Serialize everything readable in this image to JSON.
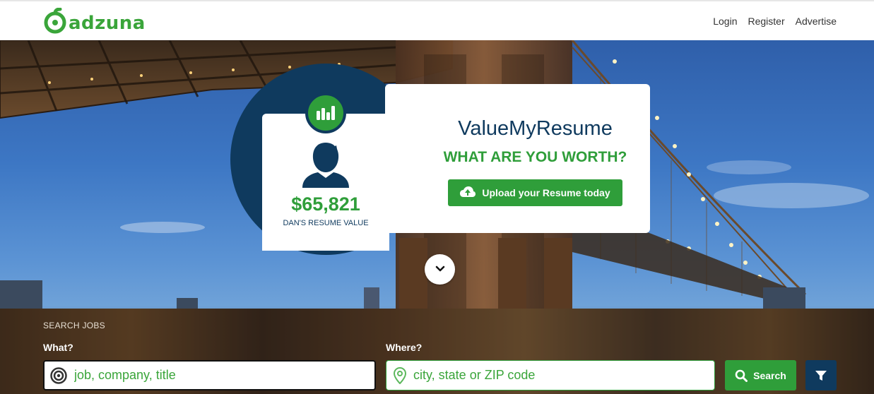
{
  "header": {
    "logo_text": "adzuna",
    "nav": [
      {
        "label": "Login"
      },
      {
        "label": "Register"
      },
      {
        "label": "Advertise"
      }
    ]
  },
  "resume_card": {
    "value": "$65,821",
    "value_label": "DAN'S RESUME VALUE",
    "brand": "ValueMyResume",
    "tagline": "WHAT ARE YOU WORTH?",
    "upload_label": "Upload your Resume today"
  },
  "search": {
    "title": "SEARCH JOBS",
    "what_label": "What?",
    "what_placeholder": "job, company, title",
    "where_label": "Where?",
    "where_placeholder": "city, state or ZIP code",
    "search_label": "Search"
  },
  "colors": {
    "brand_green": "#2f9e3a",
    "navy": "#0f3a5e"
  },
  "icons": [
    "adzuna-logo-icon",
    "bar-chart-icon",
    "person-icon",
    "cloud-upload-icon",
    "chevron-down-icon",
    "target-icon",
    "location-pin-icon",
    "search-icon",
    "filter-icon"
  ]
}
